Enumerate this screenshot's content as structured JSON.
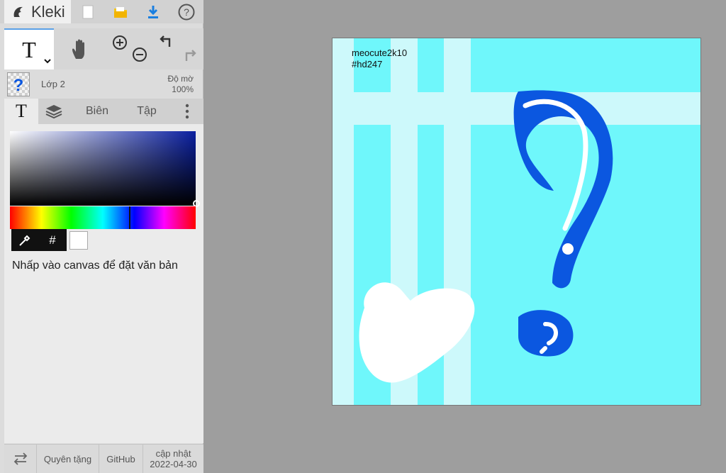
{
  "app": {
    "name": "Kleki"
  },
  "topbar": {
    "icons": [
      "new-image-icon",
      "open-folder-icon",
      "download-icon",
      "help-icon"
    ]
  },
  "tools": {
    "text": "T",
    "icons": [
      "text-tool-icon",
      "hand-tool-icon",
      "zoom-in-icon",
      "zoom-out-icon",
      "undo-icon",
      "redo-icon"
    ]
  },
  "layer": {
    "name": "Lớp 2",
    "opacity_label": "Độ mờ",
    "opacity_value": "100%"
  },
  "tabs": {
    "text_tab": "T",
    "edit": "Biên",
    "file": "Tập"
  },
  "color": {
    "primary": "#0a1fa0",
    "hex_symbol": "#",
    "swatch": "#ffffff"
  },
  "hint": "Nhấp vào canvas để đặt văn bản",
  "footer": {
    "donate": "Quyên tặng",
    "github": "GitHub",
    "update_label": "cập nhật",
    "update_date": "2022-04-30"
  },
  "canvas": {
    "watermark_line1": "meocute2k10",
    "watermark_line2": "#hd247",
    "background": "#6ff7fb",
    "stripe": "#cdf9fb",
    "ink": "#0b57e0"
  }
}
